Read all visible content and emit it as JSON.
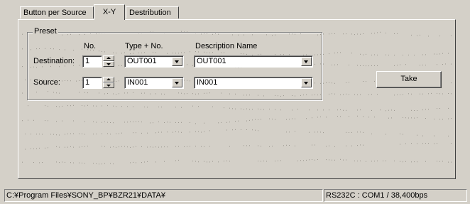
{
  "tabs": [
    "Button per Source",
    "X-Y",
    "Destribution"
  ],
  "active_tab": "X-Y",
  "preset": {
    "title": "Preset",
    "col_no": "No.",
    "col_type": "Type + No.",
    "col_desc": "Description Name",
    "destination": {
      "label": "Destination:",
      "no": "1",
      "type": "OUT001",
      "desc": "OUT001"
    },
    "source": {
      "label": "Source:",
      "no": "1",
      "type": "IN001",
      "desc": "IN001"
    }
  },
  "take_label": "Take",
  "status": {
    "path": "C:¥Program Files¥SONY_BP¥BZR21¥DATA¥",
    "port": "RS232C : COM1 / 38,400bps"
  },
  "colors": {
    "face": "#d4d0c8",
    "shadow": "#808080",
    "dark": "#404040",
    "highlight": "#ffffff"
  }
}
